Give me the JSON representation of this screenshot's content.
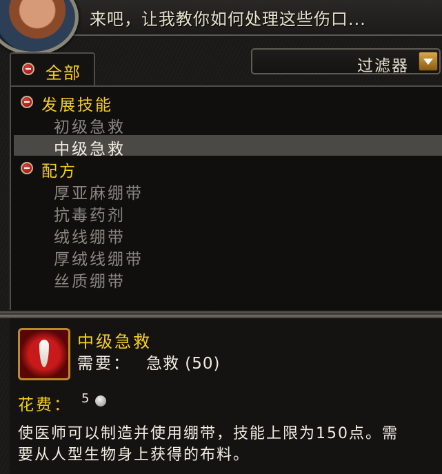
{
  "npc": {
    "greeting": "来吧，让我教你如何处理这些伤口..."
  },
  "tabs": {
    "all_label": "全部"
  },
  "filter": {
    "label": "过滤器"
  },
  "list": {
    "categories": [
      {
        "label": "发展技能",
        "items": [
          "初级急救",
          "中级急救"
        ]
      },
      {
        "label": "配方",
        "items": [
          "厚亚麻绷带",
          "抗毒药剂",
          "绒线绷带",
          "厚绒线绷带",
          "丝质绷带"
        ]
      }
    ],
    "selected_item": "中级急救"
  },
  "detail": {
    "name": "中级急救",
    "requires_label": "需要：",
    "requires_value": "急救 (50)",
    "cost_label": "花费：",
    "cost_value": "5",
    "description": "使医师可以制造并使用绷带，技能上限为150点。需要从人型生物身上获得的布料。"
  },
  "colors": {
    "gold_text": "#f4cd22",
    "white_text": "#f2eee4",
    "grey_text": "#8a8780",
    "selected_row": "#4a4945"
  }
}
